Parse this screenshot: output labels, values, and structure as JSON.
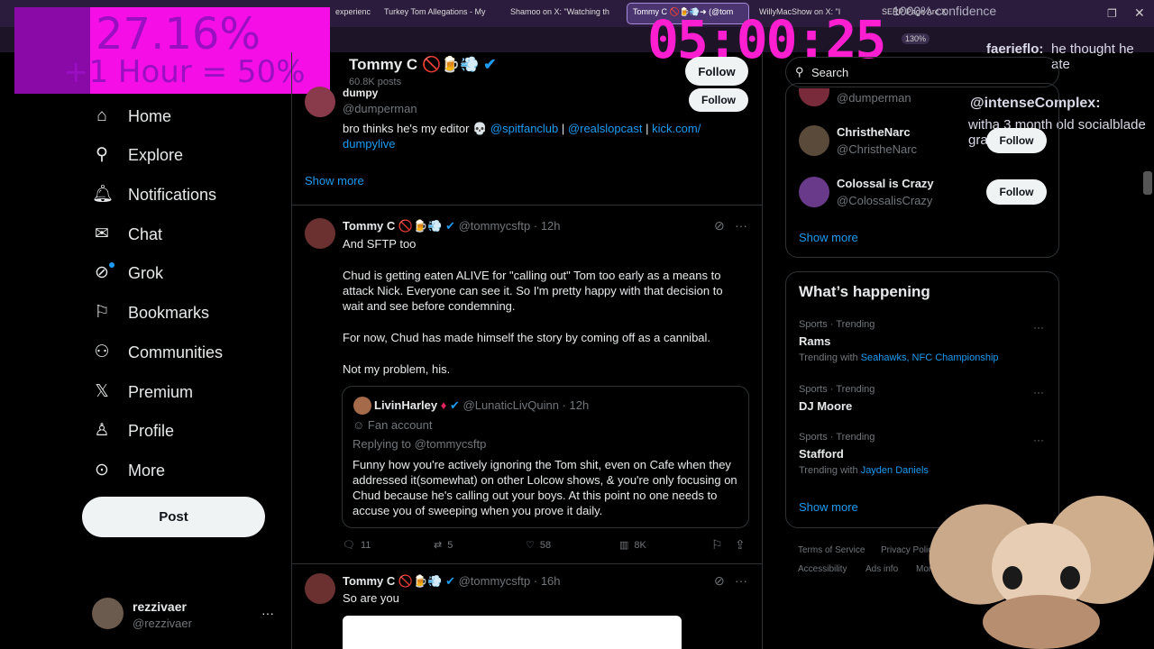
{
  "browser": {
    "tabs": [
      {
        "label": "experienc"
      },
      {
        "label": "Turkey Tom Allegations - My"
      },
      {
        "label": "Shamoo on X: \"Watching th"
      },
      {
        "label": "Tommy C 🚫🍺💨➜ (@tom"
      },
      {
        "label": "WillyMacShow on X: \"I"
      },
      {
        "label": "SERP Page Arc X"
      }
    ],
    "zoom": "130%"
  },
  "stream_overlay": {
    "goal_percent": "27.16%",
    "goal_sub": "+1 Hour = 50%",
    "timer": "05:00:25",
    "chat": [
      {
        "user": "faerieflo:",
        "text": "he thought he ate"
      },
      {
        "user": "@intenseComplex:",
        "text": "witha 3 month old socialblade graph"
      }
    ],
    "chat_misc": "1000% confidence"
  },
  "sidebar": {
    "items": [
      {
        "label": "Home",
        "icon": "home-icon"
      },
      {
        "label": "Explore",
        "icon": "search-icon"
      },
      {
        "label": "Notifications",
        "icon": "bell-icon"
      },
      {
        "label": "Chat",
        "icon": "mail-icon"
      },
      {
        "label": "Grok",
        "icon": "grok-icon"
      },
      {
        "label": "Bookmarks",
        "icon": "bookmark-icon"
      },
      {
        "label": "Communities",
        "icon": "people-icon"
      },
      {
        "label": "Premium",
        "icon": "x-icon"
      },
      {
        "label": "Profile",
        "icon": "person-icon"
      },
      {
        "label": "More",
        "icon": "more-circle-icon"
      }
    ],
    "post_label": "Post",
    "account": {
      "name": "rezzivaer",
      "handle": "@rezzivaer"
    }
  },
  "profile_header": {
    "name": "Tommy C",
    "emojis": "🚫🍺💨",
    "posts": "60.8K posts",
    "follow_label": "Follow"
  },
  "bio_card": {
    "name": "dumpy",
    "handle": "@dumperman",
    "follow_label": "Follow",
    "bio_prefix": "bro thinks he's my editor 💀",
    "bio_link1": "@spitfanclub",
    "sep1": "|",
    "bio_link2": "@realslopcast",
    "sep2": "|",
    "bio_link3": "kick.com/",
    "bio_link3b": "dumpylive",
    "show_more": "Show more"
  },
  "tweet1": {
    "name": "Tommy C",
    "emojis": "🚫🍺💨",
    "handle": "@tommycsftp",
    "time": "· 12h",
    "p1": "And SFTP too",
    "p2": "Chud is getting eaten ALIVE for \"calling out\" Tom too early as a means to attack Nick.  Everyone can see it.  So I'm pretty happy with that decision to wait and see before condemning.",
    "p3": "For now, Chud has made himself the story by coming off as a cannibal.",
    "p4": "Not my problem, his.",
    "quote": {
      "name": "LivinHarley",
      "handle": "@LunaticLivQuinn",
      "time": "· 12h",
      "fan": "Fan account",
      "replying": "Replying to @tommycsftp",
      "text": "Funny how you're actively ignoring the Tom shit, even on Cafe when they addressed it(somewhat) on other Lolcow shows, & you're only focusing on Chud because he's calling out your boys. At this point no one needs to accuse you of sweeping when you prove it daily."
    },
    "stats": {
      "replies": "11",
      "reposts": "5",
      "likes": "58",
      "views": "8K"
    }
  },
  "tweet2": {
    "name": "Tommy C",
    "emojis": "🚫🍺💨",
    "handle": "@tommycsftp",
    "time": "· 16h",
    "text": "So are you"
  },
  "right": {
    "search_placeholder": "Search",
    "who_to_follow": [
      {
        "name": "",
        "handle": "@dumperman"
      },
      {
        "name": "ChristheNarc",
        "handle": "@ChristheNarc",
        "follow": "Follow"
      },
      {
        "name": "Colossal is Crazy",
        "handle": "@ColossalisCrazy",
        "follow": "Follow"
      }
    ],
    "show_more": "Show more",
    "happening_title": "What’s happening",
    "trends": [
      {
        "meta": "Sports · Trending",
        "name": "Rams",
        "with_label": "Trending with",
        "with": "Seahawks, NFC Championship"
      },
      {
        "meta": "Sports · Trending",
        "name": "DJ Moore",
        "with_label": "",
        "with": ""
      },
      {
        "meta": "Sports · Trending",
        "name": "Stafford",
        "with_label": "Trending with",
        "with": "Jayden Daniels"
      }
    ],
    "show_more2": "Show more",
    "footer": [
      "Terms of Service",
      "Privacy Policy",
      "Accessibility",
      "Ads info",
      "More ···"
    ]
  }
}
